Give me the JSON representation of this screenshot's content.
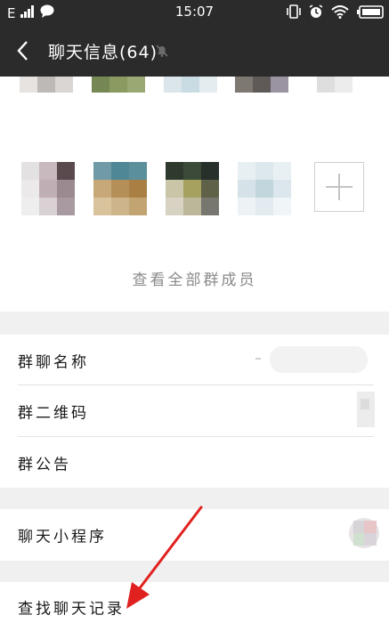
{
  "status_bar": {
    "carrier": "E",
    "time": "15:07",
    "icons": [
      "signal-icon",
      "chat-bubble-icon",
      "vibrate-icon",
      "alarm-icon",
      "wifi-icon",
      "battery-icon"
    ]
  },
  "header": {
    "back_icon": "chevron-left-icon",
    "title": "聊天信息(64)",
    "mute_icon": "muted-bell-icon"
  },
  "members": {
    "add_icon": "plus-icon",
    "view_all_label": "查看全部群成员"
  },
  "settings": {
    "group_name_label": "群聊名称",
    "qr_code_label": "群二维码",
    "announcement_label": "群公告",
    "mini_programs_label": "聊天小程序",
    "search_history_label": "查找聊天记录"
  },
  "annotation": {
    "arrow_color": "#e0211f"
  },
  "colors": {
    "bar_background": "#2b2b2b",
    "section_gap": "#f0f0f0"
  }
}
